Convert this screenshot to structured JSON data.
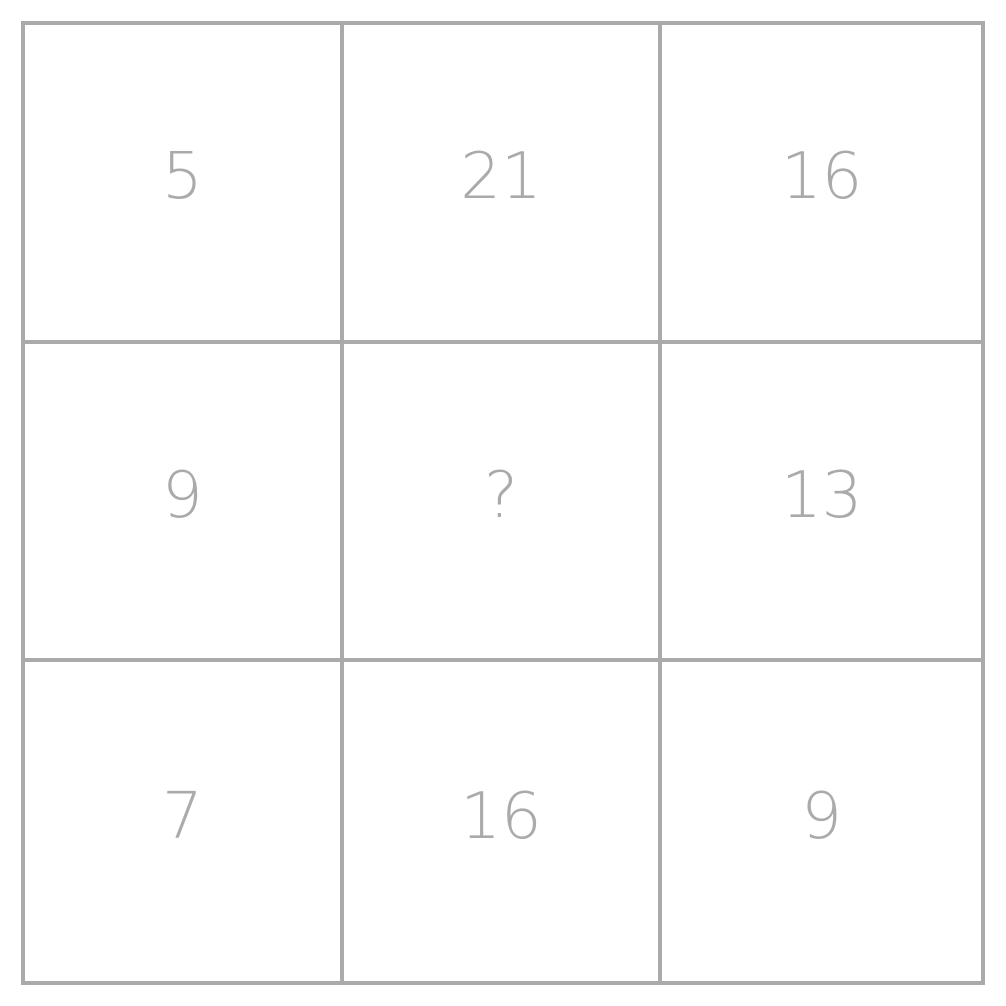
{
  "grid": {
    "rows": [
      [
        "5",
        "21",
        "16"
      ],
      [
        "9",
        "?",
        "13"
      ],
      [
        "7",
        "16",
        "9"
      ]
    ]
  },
  "colors": {
    "line": "#aaaaaa",
    "text": "#aaaaaa",
    "background": "#ffffff"
  }
}
